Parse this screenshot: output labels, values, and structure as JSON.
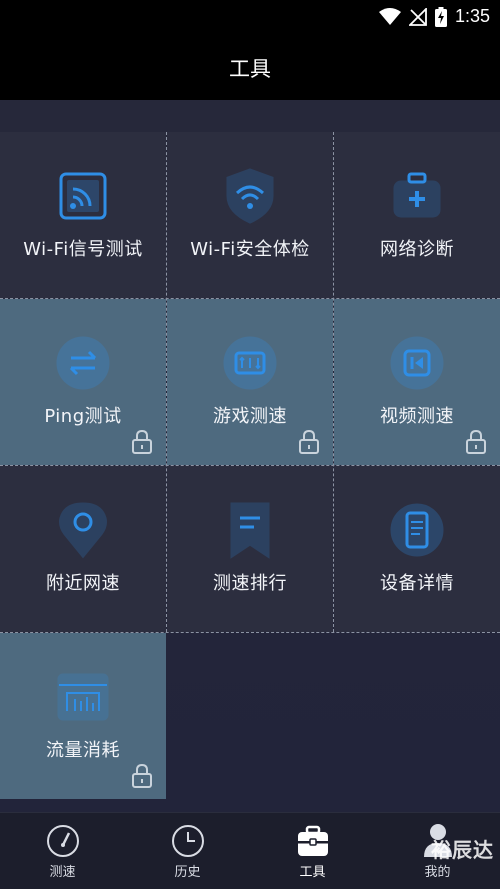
{
  "status_bar": {
    "time": "1:35"
  },
  "header": {
    "title": "工具"
  },
  "tools": [
    {
      "label": "Wi-Fi信号测试",
      "icon": "wifi-signal-icon",
      "locked": false
    },
    {
      "label": "Wi-Fi安全体检",
      "icon": "wifi-shield-icon",
      "locked": false
    },
    {
      "label": "网络诊断",
      "icon": "first-aid-kit-icon",
      "locked": false
    },
    {
      "label": "Ping测试",
      "icon": "transfer-arrows-icon",
      "locked": true
    },
    {
      "label": "游戏测速",
      "icon": "game-speed-icon",
      "locked": true
    },
    {
      "label": "视频测速",
      "icon": "video-play-icon",
      "locked": true
    },
    {
      "label": "附近网速",
      "icon": "location-pin-icon",
      "locked": false
    },
    {
      "label": "测速排行",
      "icon": "bookmark-ranking-icon",
      "locked": false
    },
    {
      "label": "设备详情",
      "icon": "phone-device-icon",
      "locked": false
    },
    {
      "label": "流量消耗",
      "icon": "traffic-meter-icon",
      "locked": true
    }
  ],
  "bottom_nav": [
    {
      "label": "测速",
      "icon": "speedometer-icon",
      "active": false
    },
    {
      "label": "历史",
      "icon": "clock-icon",
      "active": false
    },
    {
      "label": "工具",
      "icon": "toolbox-icon",
      "active": true
    },
    {
      "label": "我的",
      "icon": "profile-icon",
      "active": false
    }
  ],
  "watermark": "裕辰达",
  "colors": {
    "accent": "#2f8ee6",
    "tile_free": "#2c2e3f",
    "tile_locked": "#4e6a7f",
    "bar_bg": "#000000"
  }
}
